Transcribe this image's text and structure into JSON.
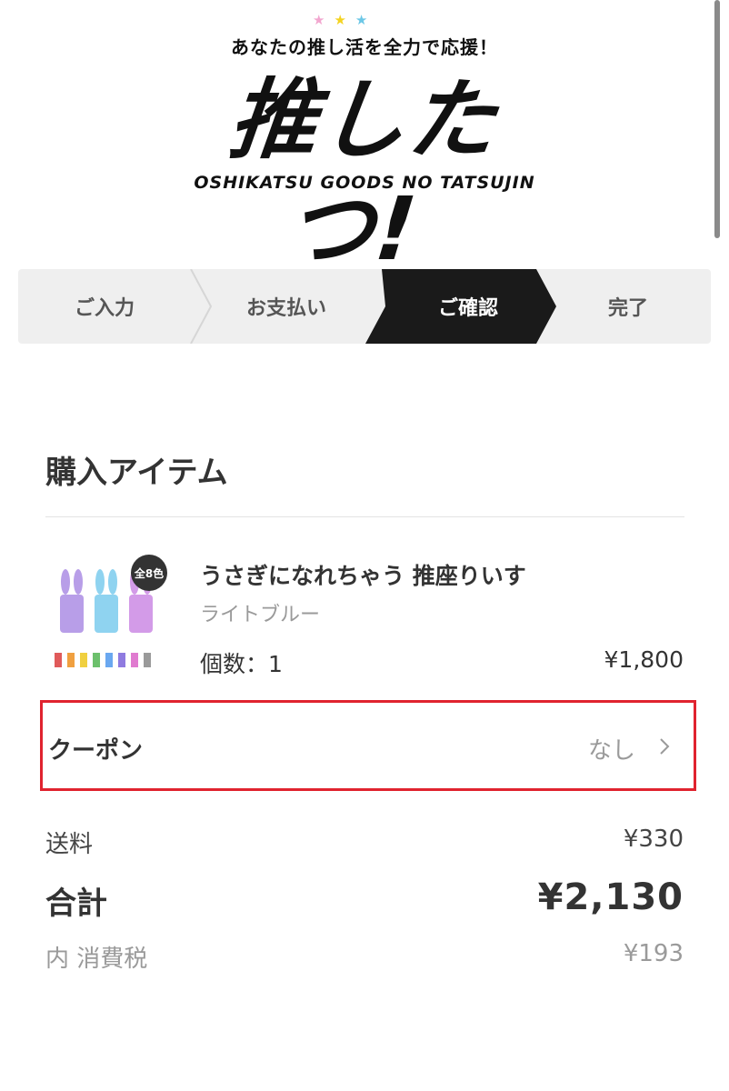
{
  "header": {
    "stars": [
      "★",
      "★",
      "★"
    ],
    "star_colors": [
      "#f2a6cf",
      "#f4d321",
      "#6cc7e6"
    ],
    "tagline": "あなたの推し活を全力で応援！",
    "logo": "推したつ!",
    "logo_sub": "OSHIKATSU GOODS NO TATSUJIN"
  },
  "stepper": {
    "steps": [
      {
        "label": "ご入力"
      },
      {
        "label": "お支払い"
      },
      {
        "label": "ご確認"
      },
      {
        "label": "完了"
      }
    ],
    "active_index": 2,
    "active_color": "#1a1a1a"
  },
  "order": {
    "section_title": "購入アイテム",
    "item": {
      "badge": "全8色",
      "name": "うさぎになれちゃう 推座りいす",
      "variant": "ライトブルー",
      "qty_label": "個数：1",
      "price": "¥1,800"
    },
    "coupon": {
      "label": "クーポン",
      "value": "なし",
      "highlight_color": "#e0232f"
    },
    "shipping": {
      "label": "送料",
      "value": "¥330"
    },
    "total": {
      "label": "合計",
      "value": "¥2,130"
    },
    "tax": {
      "label": "内 消費税",
      "value": "¥193"
    }
  }
}
